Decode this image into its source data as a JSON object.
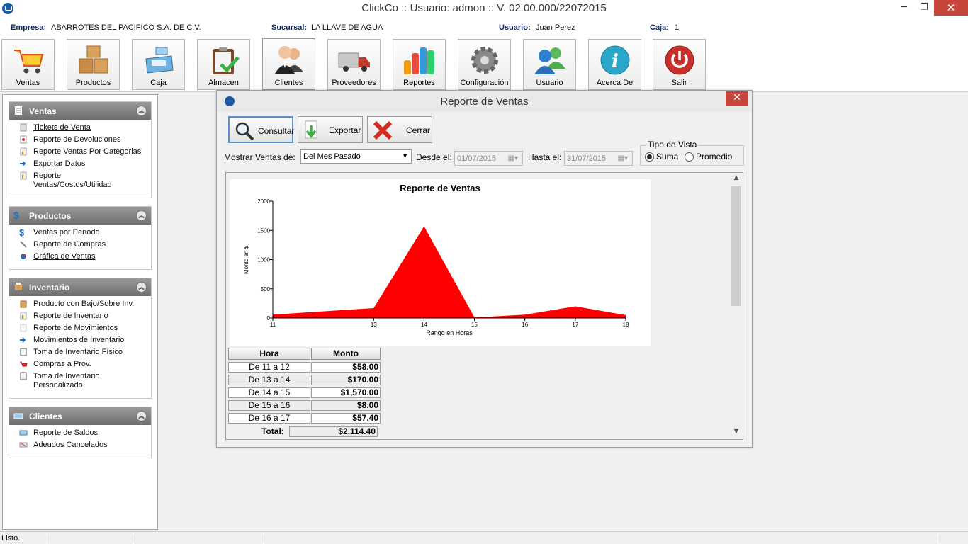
{
  "window": {
    "title": "ClickCo :: Usuario: admon :: V. 02.00.000/22072015",
    "min_glyph": "─",
    "max_glyph": "❐",
    "close_glyph": "✕"
  },
  "info": {
    "empresa_label": "Empresa:",
    "empresa_value": "ABARROTES DEL PACIFICO S.A. DE C.V.",
    "sucursal_label": "Sucursal:",
    "sucursal_value": "LA LLAVE DE AGUA",
    "usuario_label": "Usuario:",
    "usuario_value": "Juan Perez",
    "caja_label": "Caja:",
    "caja_value": "1"
  },
  "toolbar": [
    {
      "label": "Ventas",
      "icon": "shopping-cart-icon"
    },
    {
      "label": "Productos",
      "icon": "boxes-icon"
    },
    {
      "label": "Caja",
      "icon": "cash-register-icon"
    },
    {
      "label": "Almacen",
      "icon": "clipboard-check-icon"
    },
    {
      "label": "Clientes",
      "icon": "people-icon"
    },
    {
      "label": "Proveedores",
      "icon": "truck-icon"
    },
    {
      "label": "Reportes",
      "icon": "bar-chart-icon"
    },
    {
      "label": "Configuración",
      "icon": "gear-icon"
    },
    {
      "label": "Usuario",
      "icon": "users-icon"
    },
    {
      "label": "Acerca De",
      "icon": "info-icon"
    },
    {
      "label": "Salir",
      "icon": "power-icon"
    }
  ],
  "sidebar": {
    "ventas": {
      "title": "Ventas",
      "items": [
        "Tickets de Venta",
        "Reporte de Devoluciones",
        "Reporte Ventas Por Categorias",
        "Exportar Datos",
        "Reporte Ventas/Costos/Utilidad"
      ]
    },
    "productos": {
      "title": "Productos",
      "items": [
        "Ventas por Periodo",
        "Reporte de Compras",
        "Gráfica de Ventas"
      ]
    },
    "inventario": {
      "title": "Inventario",
      "items": [
        "Producto con Bajo/Sobre Inv.",
        "Reporte de Inventario",
        "Reporte de Movimientos",
        "Movimientos de Inventario",
        "Toma de Inventario Físico",
        "Compras a Prov.",
        "Toma de Inventario Personalizado"
      ]
    },
    "clientes": {
      "title": "Clientes",
      "items": [
        "Reporte de Saldos",
        "Adeudos Cancelados"
      ]
    }
  },
  "dialog": {
    "title": "Reporte de Ventas",
    "close_glyph": "✕",
    "btn_consultar": "Consultar",
    "btn_exportar": "Exportar",
    "btn_cerrar": "Cerrar",
    "mostrar_label": "Mostrar Ventas de:",
    "mostrar_value": "Del Mes Pasado",
    "desde_label": "Desde el:",
    "desde_value": "01/07/2015",
    "hasta_label": "Hasta el:",
    "hasta_value": "31/07/2015",
    "tipo_vista_title": "Tipo de Vista",
    "tipo_vista_options": [
      "Suma",
      "Promedio"
    ],
    "tipo_vista_selected": "Suma"
  },
  "chart_data": {
    "type": "area",
    "title": "Reporte de Ventas",
    "xlabel": "Rango en Horas",
    "ylabel": "Monto en $",
    "x": [
      11,
      13,
      14,
      15,
      16,
      17,
      18
    ],
    "values": [
      58,
      170,
      1570,
      8,
      57.4,
      200,
      50
    ],
    "x_ticks": [
      11,
      13,
      14,
      15,
      16,
      17,
      18
    ],
    "y_ticks": [
      0,
      500,
      1000,
      1500,
      2000
    ],
    "ylim": [
      0,
      2000
    ],
    "color": "#ff0000"
  },
  "table": {
    "headers": [
      "Hora",
      "Monto"
    ],
    "rows": [
      {
        "hora": "De 11 a 12",
        "monto": "$58.00"
      },
      {
        "hora": "De 13 a 14",
        "monto": "$170.00"
      },
      {
        "hora": "De 14 a 15",
        "monto": "$1,570.00"
      },
      {
        "hora": "De 15 a 16",
        "monto": "$8.00"
      },
      {
        "hora": "De 16 a 17",
        "monto": "$57.40"
      }
    ],
    "total_label": "Total:",
    "total_value": "$2,114.40"
  },
  "status": {
    "text": "Listo."
  }
}
